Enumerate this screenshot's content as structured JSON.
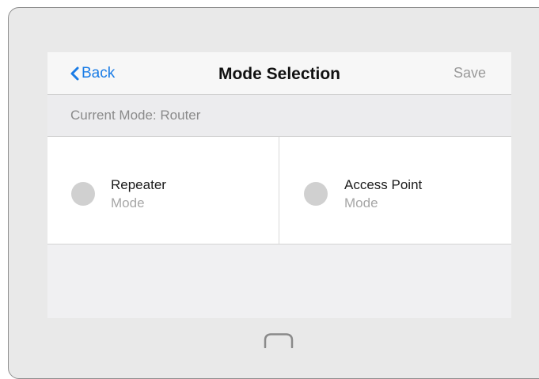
{
  "nav": {
    "back_label": "Back",
    "title": "Mode Selection",
    "save_label": "Save"
  },
  "current_mode": {
    "text": "Current Mode: Router"
  },
  "modes": [
    {
      "name": "Repeater",
      "subtitle": "Mode",
      "selected": false
    },
    {
      "name": "Access Point",
      "subtitle": "Mode",
      "selected": false
    }
  ],
  "colors": {
    "accent": "#1a7ce6",
    "radio_unselected": "#d0d0d0",
    "device_frame": "#e9e9e9"
  },
  "icons": {
    "back": "chevron-left-icon",
    "home": "home-button-icon"
  }
}
